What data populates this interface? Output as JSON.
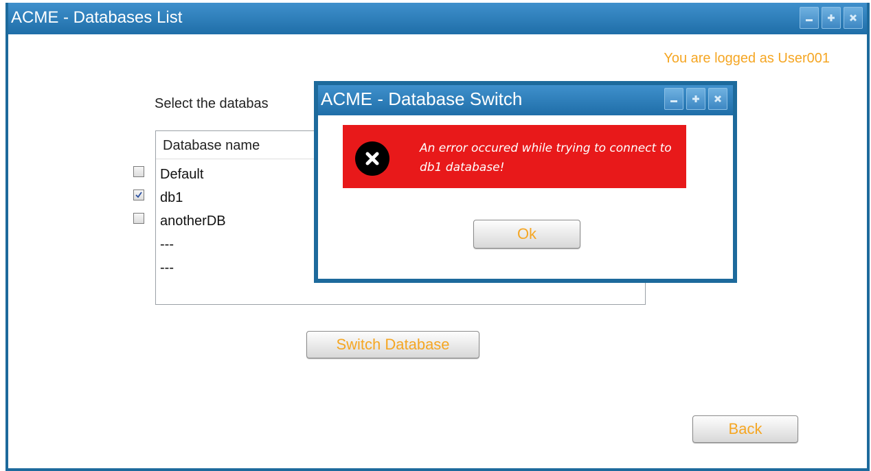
{
  "main_window": {
    "title": "ACME - Databases List",
    "logged_text": "You are logged as User001",
    "select_label": "Select the databas",
    "table": {
      "column_header": "Database name",
      "rows": [
        "Default",
        "db1",
        "anotherDB",
        "---",
        "---"
      ]
    },
    "checkboxes": [
      {
        "label": "Default",
        "checked": false
      },
      {
        "label": "db1",
        "checked": true
      },
      {
        "label": "anotherDB",
        "checked": false
      }
    ],
    "switch_button": "Switch Database",
    "back_button": "Back"
  },
  "modal": {
    "title": "ACME - Database Switch",
    "error_message": "An error occured while trying to connect to db1 database!",
    "ok_button": "Ok"
  },
  "icons": {
    "minimize": "minimize-icon",
    "maximize": "plus-icon",
    "close": "close-icon",
    "error": "error-x-icon"
  },
  "colors": {
    "titlebar": "#2a7bb8",
    "accent_text": "#f5a623",
    "error_bg": "#e8191a"
  }
}
